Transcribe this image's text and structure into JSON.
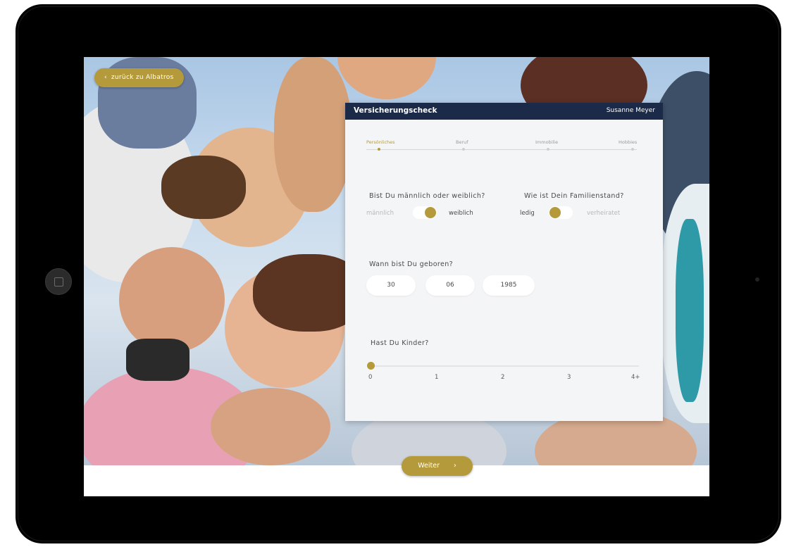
{
  "header": {
    "back_label": "zurück zu Albatros",
    "back_icon": "chevron-left-icon",
    "title": "Versicherungscheck",
    "user": "Susanne Meyer"
  },
  "steps": {
    "items": [
      {
        "label": "Persönliches",
        "active": true
      },
      {
        "label": "Beruf",
        "active": false
      },
      {
        "label": "Immobilie",
        "active": false
      },
      {
        "label": "Hobbies",
        "active": false
      }
    ]
  },
  "gender": {
    "question": "Bist Du männlich oder weiblich?",
    "left": "männlich",
    "right": "weiblich",
    "selected": "weiblich"
  },
  "marital": {
    "question": "Wie ist Dein Familienstand?",
    "left": "ledig",
    "right": "verheiratet",
    "selected": "ledig"
  },
  "birth": {
    "question": "Wann bist Du geboren?",
    "day": "30",
    "month": "06",
    "year": "1985"
  },
  "children": {
    "question": "Hast Du Kinder?",
    "ticks": [
      "0",
      "1",
      "2",
      "3",
      "4+"
    ],
    "value": "0"
  },
  "footer": {
    "next_label": "Weiter",
    "next_icon": "chevron-right-icon"
  },
  "colors": {
    "accent": "#b59a3b",
    "header": "#1a2a48"
  }
}
